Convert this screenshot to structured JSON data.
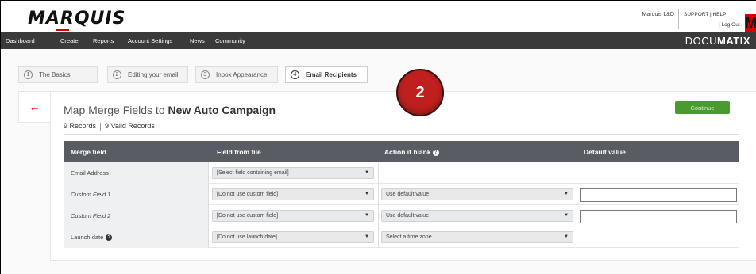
{
  "header": {
    "logo": "MARQUIS",
    "user": "Marquis L&D",
    "support": "SUPPORT | HELP",
    "logout": "| Log Out",
    "brand_badge": "M"
  },
  "nav": {
    "items": [
      "Dashboard",
      "Create",
      "Reports",
      "Account Settings",
      "News",
      "Community"
    ],
    "product_light": "DOCU",
    "product_bold": "MATIX"
  },
  "steps": [
    {
      "num": "1",
      "label": "The Basics"
    },
    {
      "num": "2",
      "label": "Editing your email"
    },
    {
      "num": "3",
      "label": "Inbox Appearance"
    },
    {
      "num": "4",
      "label": "Email Recipients"
    }
  ],
  "annotation_badge": "2",
  "page": {
    "back_icon": "←",
    "title_prefix": "Map Merge Fields to",
    "title_campaign": "New Auto Campaign",
    "records": "9 Records",
    "valid_records": "9 Valid Records",
    "continue_label": "Continue"
  },
  "table": {
    "headers": {
      "merge_field": "Merge field",
      "field_from_file": "Field from file",
      "action_if_blank": "Action if blank",
      "default_value": "Default value"
    },
    "rows": [
      {
        "label": "Email Address",
        "field": "[Select field containing email]",
        "action": ""
      },
      {
        "label": "Custom Field 1",
        "field": "[Do not use custom field]",
        "action": "Use default value"
      },
      {
        "label": "Custom Field 2",
        "field": "[Do not use custom field]",
        "action": "Use default value"
      },
      {
        "label": "Launch date",
        "field": "[Do not use launch date]",
        "action": "Select a time zone"
      }
    ]
  },
  "colors": {
    "brand_red": "#d40000",
    "nav_bg": "#3a3a3a",
    "table_header": "#595d63",
    "continue_green": "#4a9b2f",
    "badge_red": "#c0201d"
  }
}
